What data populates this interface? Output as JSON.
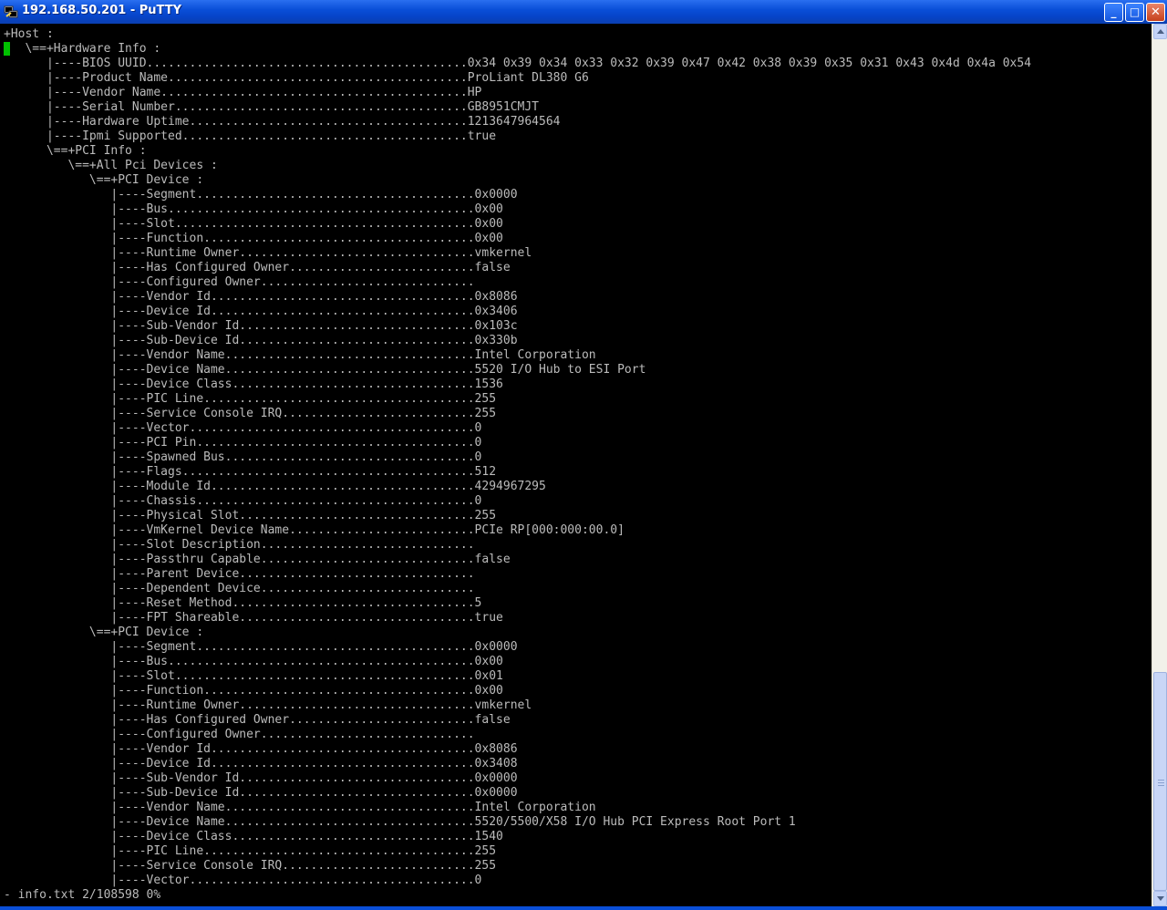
{
  "window": {
    "title": "192.168.50.201 - PuTTY",
    "icon": "putty-icon",
    "controls": {
      "minimize": "_",
      "maximize": "□",
      "close": "✕"
    }
  },
  "terminal": {
    "lines": [
      "+Host :",
      "   \\==+Hardware Info :",
      "      |----BIOS UUID.............................................0x34 0x39 0x34 0x33 0x32 0x39 0x47 0x42 0x38 0x39 0x35 0x31 0x43 0x4d 0x4a 0x54",
      "      |----Product Name..........................................ProLiant DL380 G6",
      "      |----Vendor Name...........................................HP",
      "      |----Serial Number.........................................GB8951CMJT",
      "      |----Hardware Uptime.......................................1213647964564",
      "      |----Ipmi Supported........................................true",
      "      \\==+PCI Info :",
      "         \\==+All Pci Devices :",
      "            \\==+PCI Device :",
      "               |----Segment.......................................0x0000",
      "               |----Bus...........................................0x00",
      "               |----Slot..........................................0x00",
      "               |----Function......................................0x00",
      "               |----Runtime Owner.................................vmkernel",
      "               |----Has Configured Owner..........................false",
      "               |----Configured Owner..............................",
      "               |----Vendor Id.....................................0x8086",
      "               |----Device Id.....................................0x3406",
      "               |----Sub-Vendor Id.................................0x103c",
      "               |----Sub-Device Id.................................0x330b",
      "               |----Vendor Name...................................Intel Corporation",
      "               |----Device Name...................................5520 I/O Hub to ESI Port",
      "               |----Device Class..................................1536",
      "               |----PIC Line......................................255",
      "               |----Service Console IRQ...........................255",
      "               |----Vector........................................0",
      "               |----PCI Pin.......................................0",
      "               |----Spawned Bus...................................0",
      "               |----Flags.........................................512",
      "               |----Module Id.....................................4294967295",
      "               |----Chassis.......................................0",
      "               |----Physical Slot.................................255",
      "               |----VmKernel Device Name..........................PCIe RP[000:000:00.0]",
      "               |----Slot Description..............................",
      "               |----Passthru Capable..............................false",
      "               |----Parent Device.................................",
      "               |----Dependent Device..............................",
      "               |----Reset Method..................................5",
      "               |----FPT Shareable.................................true",
      "            \\==+PCI Device :",
      "               |----Segment.......................................0x0000",
      "               |----Bus...........................................0x00",
      "               |----Slot..........................................0x01",
      "               |----Function......................................0x00",
      "               |----Runtime Owner.................................vmkernel",
      "               |----Has Configured Owner..........................false",
      "               |----Configured Owner..............................",
      "               |----Vendor Id.....................................0x8086",
      "               |----Device Id.....................................0x3408",
      "               |----Sub-Vendor Id.................................0x0000",
      "               |----Sub-Device Id.................................0x0000",
      "               |----Vendor Name...................................Intel Corporation",
      "               |----Device Name...................................5520/5500/X58 I/O Hub PCI Express Root Port 1",
      "               |----Device Class..................................1540",
      "               |----PIC Line......................................255",
      "               |----Service Console IRQ...........................255",
      "               |----Vector........................................0"
    ],
    "status_line": "- info.txt 2/108598 0%",
    "text_color": "#bbbbbb",
    "background_color": "#000000",
    "cursor_color": "#00c000"
  },
  "scrollbar": {
    "position_fraction": 1.0
  }
}
